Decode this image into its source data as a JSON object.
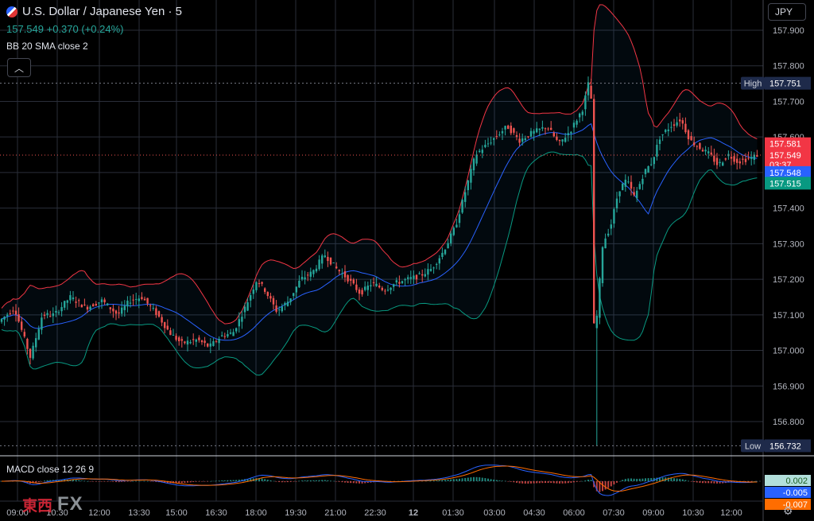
{
  "header": {
    "symbol": "U.S. Dollar / Japanese Yen · 5",
    "last": "157.549",
    "change": "+0.370",
    "change_pct": "(+0.24%)",
    "indicator": "BB 20 SMA close 2",
    "collapse_icon": "chevron-up-icon"
  },
  "currency": "JPY",
  "macd_label": "MACD close 12 26 9",
  "watermark": {
    "cn": "東西",
    "fx": "FX"
  },
  "colors": {
    "up": "#26a69a",
    "down": "#ef5350",
    "bb_upper": "#f23645",
    "bb_lower": "#089981",
    "bb_basis": "#2962ff",
    "macd": "#2962ff",
    "signal": "#ff6d00"
  },
  "chart_data": {
    "type": "candlestick",
    "yticks": [
      "157.900",
      "157.800",
      "157.700",
      "157.600",
      "157.500",
      "157.400",
      "157.300",
      "157.200",
      "157.100",
      "157.000",
      "156.900",
      "156.800"
    ],
    "xticks": [
      "09:00",
      "10:30",
      "12:00",
      "13:30",
      "15:00",
      "16:30",
      "18:00",
      "19:30",
      "21:00",
      "22:30",
      "12",
      "01:30",
      "03:00",
      "04:30",
      "06:00",
      "07:30",
      "09:00",
      "10:30",
      "12:00"
    ],
    "ylim": [
      156.72,
      157.95
    ],
    "price_labels": [
      {
        "label": "High",
        "value": "157.751",
        "price": 157.751,
        "color": "#1e2a4a"
      },
      {
        "label": "",
        "value": "157.581",
        "price": 157.581,
        "color": "#f23645"
      },
      {
        "label": "",
        "value": "157.549",
        "price": 157.549,
        "color": "#f23645"
      },
      {
        "label": "",
        "value": "03:37",
        "price": 157.522,
        "color": "#f23645"
      },
      {
        "label": "",
        "value": "157.548",
        "price": 157.5,
        "color": "#2962ff"
      },
      {
        "label": "",
        "value": "157.515",
        "price": 157.47,
        "color": "#089981"
      },
      {
        "label": "Low",
        "value": "156.732",
        "price": 156.732,
        "color": "#1e2a4a"
      }
    ],
    "macd_labels": [
      {
        "value": "0.002",
        "color": "#b2dfdb",
        "text": "#1b5e20"
      },
      {
        "value": "-0.005",
        "color": "#2962ff",
        "text": "#ffffff"
      },
      {
        "value": "-0.007",
        "color": "#ff6d00",
        "text": "#ffffff"
      }
    ],
    "path_points": [
      [
        0,
        157.08
      ],
      [
        20,
        157.12
      ],
      [
        40,
        156.98
      ],
      [
        55,
        157.1
      ],
      [
        70,
        157.1
      ],
      [
        90,
        157.15
      ],
      [
        110,
        157.12
      ],
      [
        130,
        157.14
      ],
      [
        150,
        157.1
      ],
      [
        165,
        157.14
      ],
      [
        180,
        157.15
      ],
      [
        200,
        157.1
      ],
      [
        215,
        157.05
      ],
      [
        230,
        157.02
      ],
      [
        250,
        157.03
      ],
      [
        265,
        157.01
      ],
      [
        280,
        157.04
      ],
      [
        295,
        157.05
      ],
      [
        310,
        157.12
      ],
      [
        325,
        157.2
      ],
      [
        335,
        157.17
      ],
      [
        350,
        157.11
      ],
      [
        365,
        157.14
      ],
      [
        380,
        157.2
      ],
      [
        395,
        157.22
      ],
      [
        410,
        157.27
      ],
      [
        425,
        157.23
      ],
      [
        440,
        157.2
      ],
      [
        455,
        157.16
      ],
      [
        470,
        157.19
      ],
      [
        485,
        157.17
      ],
      [
        500,
        157.19
      ],
      [
        515,
        157.2
      ],
      [
        530,
        157.21
      ],
      [
        545,
        157.23
      ],
      [
        560,
        157.28
      ],
      [
        575,
        157.35
      ],
      [
        585,
        157.43
      ],
      [
        600,
        157.55
      ],
      [
        610,
        157.57
      ],
      [
        625,
        157.6
      ],
      [
        640,
        157.63
      ],
      [
        655,
        157.59
      ],
      [
        670,
        157.61
      ],
      [
        690,
        157.63
      ],
      [
        705,
        157.58
      ],
      [
        720,
        157.62
      ],
      [
        735,
        157.68
      ],
      [
        742,
        157.75
      ],
      [
        746,
        157.7
      ],
      [
        750,
        156.86
      ],
      [
        752,
        157.08
      ],
      [
        760,
        157.3
      ],
      [
        770,
        157.35
      ],
      [
        780,
        157.45
      ],
      [
        790,
        157.48
      ],
      [
        800,
        157.43
      ],
      [
        812,
        157.5
      ],
      [
        822,
        157.53
      ],
      [
        832,
        157.6
      ],
      [
        845,
        157.63
      ],
      [
        858,
        157.65
      ],
      [
        870,
        157.59
      ],
      [
        882,
        157.57
      ],
      [
        895,
        157.55
      ],
      [
        905,
        157.52
      ],
      [
        918,
        157.55
      ],
      [
        930,
        157.53
      ],
      [
        945,
        157.54
      ],
      [
        955,
        157.55
      ]
    ]
  }
}
